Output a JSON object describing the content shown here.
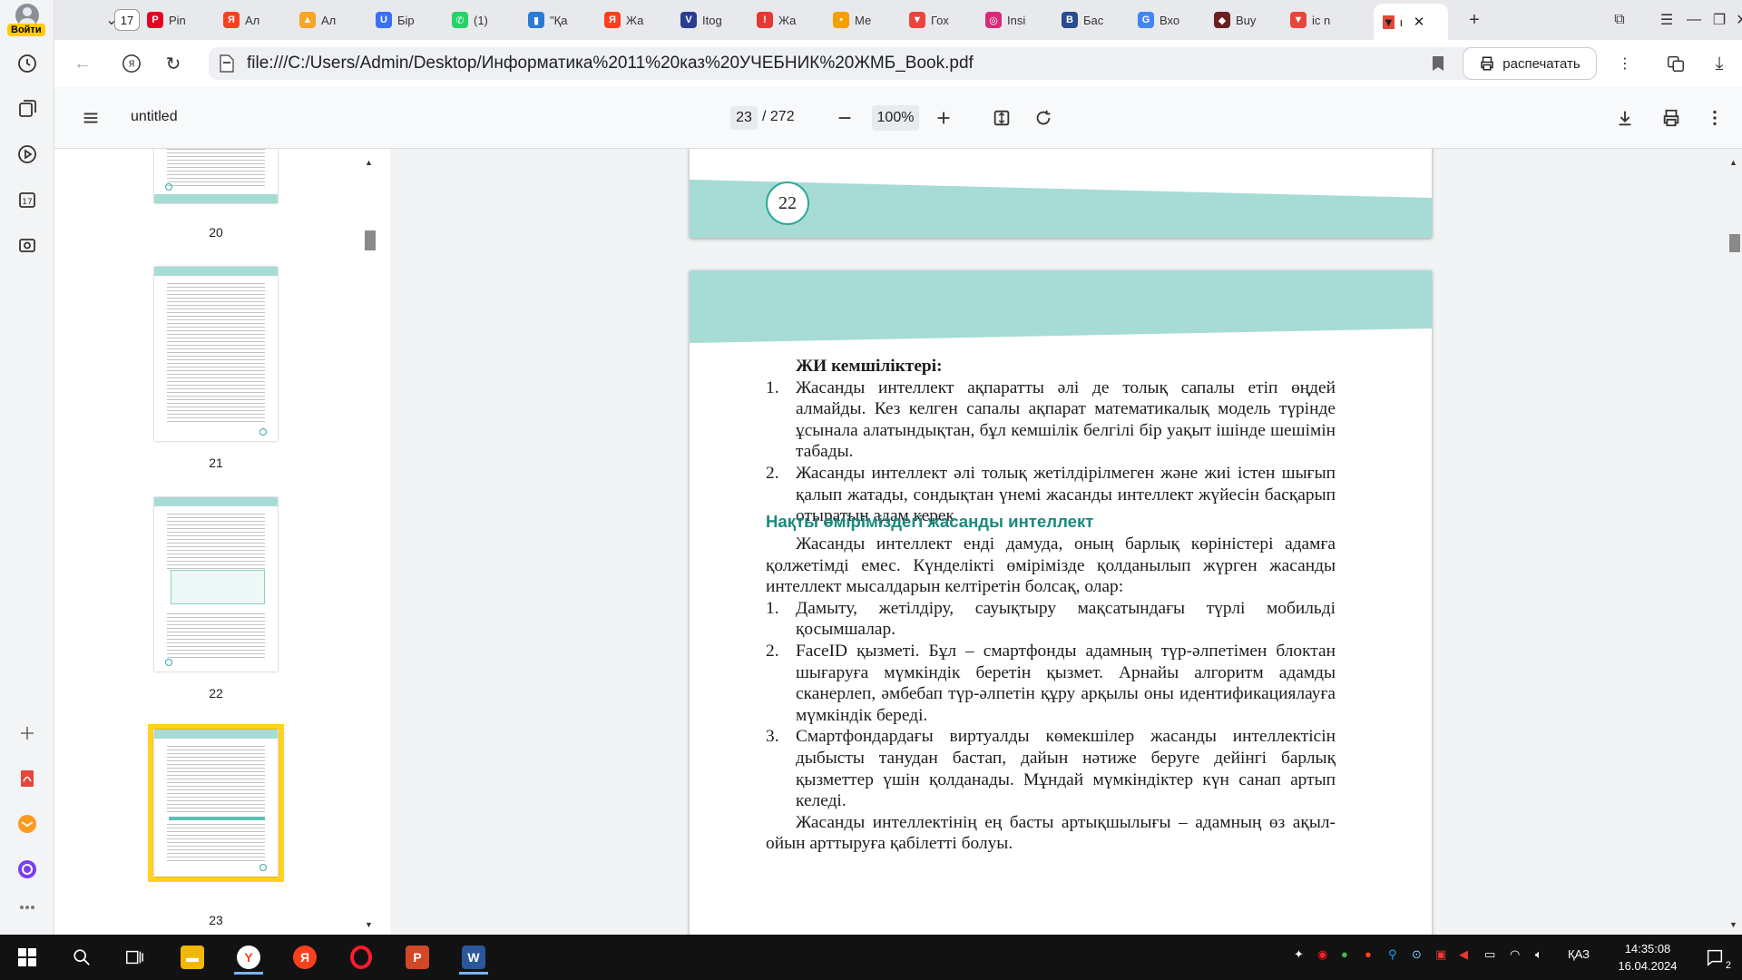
{
  "browser": {
    "profile_label": "Войти",
    "tab_count": "17",
    "tabs": [
      {
        "title": "Pin",
        "icon": "pinterest-icon",
        "color": "#e60023",
        "glyph": "P"
      },
      {
        "title": "Ал",
        "icon": "yandex-icon",
        "color": "#fc3f1d",
        "glyph": "Я"
      },
      {
        "title": "Ал",
        "icon": "image-icon",
        "color": "#f5a623",
        "glyph": "▲"
      },
      {
        "title": "Бір",
        "icon": "u-icon",
        "color": "#3b6ff5",
        "glyph": "U"
      },
      {
        "title": "(1)",
        "icon": "whatsapp-icon",
        "color": "#25d366",
        "glyph": "✆"
      },
      {
        "title": "\"Қа",
        "icon": "book-icon",
        "color": "#2b7bd6",
        "glyph": "▮"
      },
      {
        "title": "Жа",
        "icon": "yandex-icon",
        "color": "#fc3f1d",
        "glyph": "Я"
      },
      {
        "title": "Itog",
        "icon": "shield-icon",
        "color": "#2a3d8f",
        "glyph": "V"
      },
      {
        "title": "Жа",
        "icon": "alert-icon",
        "color": "#e53935",
        "glyph": "!"
      },
      {
        "title": "Ме",
        "icon": "dots-icon",
        "color": "#f59f00",
        "glyph": "•"
      },
      {
        "title": "Гох",
        "icon": "pdf-icon",
        "color": "#e8453c",
        "glyph": "▼"
      },
      {
        "title": "Insi",
        "icon": "instagram-icon",
        "color": "#d62976",
        "glyph": "◎"
      },
      {
        "title": "Бас",
        "icon": "bn-icon",
        "color": "#2a4b8d",
        "glyph": "B"
      },
      {
        "title": "Вхо",
        "icon": "google-icon",
        "color": "#4285f4",
        "glyph": "G"
      },
      {
        "title": "Buy",
        "icon": "app-icon",
        "color": "#6b1f1f",
        "glyph": "◆"
      },
      {
        "title": "ic n",
        "icon": "pdf-icon",
        "color": "#e8453c",
        "glyph": "▼"
      }
    ],
    "active_tab": {
      "title": "ι",
      "icon": "pdf-icon"
    },
    "url": "file:///C:/Users/Admin/Desktop/Информатика%2011%20каз%20УЧЕБНИК%20ЖМБ_Book.pdf",
    "print_label": "распечатать"
  },
  "pdf": {
    "title": "untitled",
    "page_current": "23",
    "page_total": "/ 272",
    "zoom": "100%"
  },
  "thumbnails": [
    {
      "label": "20"
    },
    {
      "label": "21"
    },
    {
      "label": "22"
    },
    {
      "label": "23"
    }
  ],
  "page": {
    "prev_page_number": "22",
    "disadvantages_heading": "ЖИ кемшіліктері:",
    "disadvantages": [
      {
        "n": "1.",
        "text": "Жасанды интеллект ақпаратты әлі де толық сапалы етіп өңдей алмайды. Кез келген сапалы ақпарат математикалық модель түрінде ұсынала алатындықтан, бұл кемшілік белгілі бір уақыт ішінде шешімін табады."
      },
      {
        "n": "2.",
        "text": "Жасанды интеллект әлі толық жетілдірілмеген және жиі істен шығып қалып жатады, сондықтан үнемі жасанды интеллект жүйесін басқарып отыратын адам керек."
      }
    ],
    "section_heading": "Нақты өміріміздегі жасанды интеллект",
    "intro": "Жасанды интеллект енді дамуда, оның барлық көріністері адамға қолжетімді емес. Күнделікті өмірімізде қолданылып жүрген жасанды интеллект мысалдарын келтіретін болсақ, олар:",
    "examples": [
      {
        "n": "1.",
        "text": "Дамыту, жетілдіру, сауықтыру мақсатындағы түрлі мобильді қосымшалар."
      },
      {
        "n": "2.",
        "text": "FaceID қызметі. Бұл – смартфонды адамның түр-әлпетімен блоктан шығаруға мүмкіндік беретін қызмет. Арнайы алгоритм адамды сканерлеп, әмбебап түр-әлпетін құру арқылы оны идентификациялауға мүмкіндік береді."
      },
      {
        "n": "3.",
        "text": "Смартфондардағы виртуалды көмекшілер жасанды интеллектісін дыбысты танудан бастап, дайын нәтиже беруге дейінгі барлық қызметтер үшін қолданады. Мұндай мүмкіндіктер күн санап артып келеді."
      }
    ],
    "closing": "Жасанды интеллектінің ең басты артықшылығы – адамның өз ақыл-ойын арттыруға қабілетті болуы."
  },
  "taskbar": {
    "lang": "ҚАЗ",
    "time": "14:35:08",
    "date": "16.04.2024",
    "notifications": "2"
  },
  "colors": {
    "teal_band": "#a7dcd6",
    "teal_heading": "#1a8a7e",
    "thumb_selection": "#ffd21f"
  }
}
